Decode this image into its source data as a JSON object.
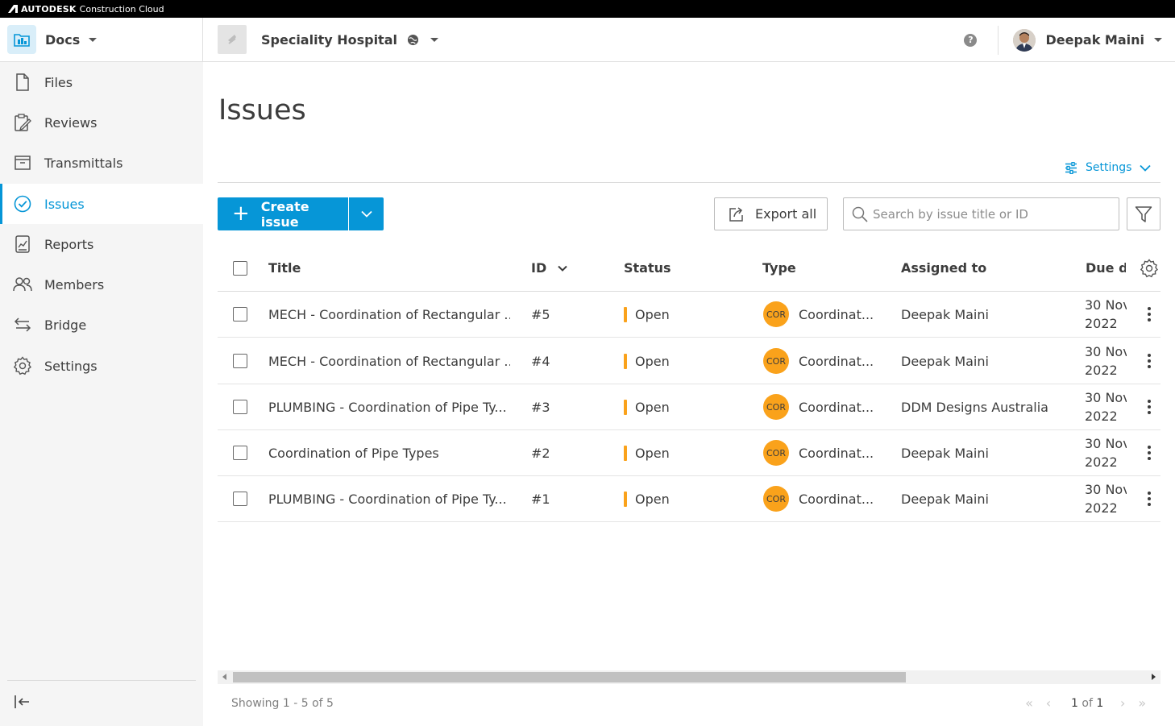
{
  "brand": {
    "name_bold": "AUTODESK",
    "name_rest": "Construction Cloud"
  },
  "header": {
    "module": "Docs",
    "project": "Speciality Hospital",
    "help_glyph": "?",
    "user": "Deepak Maini"
  },
  "sidebar": {
    "items": [
      {
        "label": "Files",
        "icon": "file-icon"
      },
      {
        "label": "Reviews",
        "icon": "review-clipboard-icon"
      },
      {
        "label": "Transmittals",
        "icon": "transmittal-tray-icon"
      },
      {
        "label": "Issues",
        "icon": "check-circle-icon",
        "active": true
      },
      {
        "label": "Reports",
        "icon": "report-icon"
      },
      {
        "label": "Members",
        "icon": "members-icon"
      },
      {
        "label": "Bridge",
        "icon": "bridge-arrows-icon"
      },
      {
        "label": "Settings",
        "icon": "gear-icon"
      }
    ]
  },
  "page": {
    "title": "Issues",
    "settings_label": "Settings"
  },
  "toolbar": {
    "create_label": "Create issue",
    "create_glyph": "+",
    "export_label": "Export all",
    "search_placeholder": "Search by issue title or ID"
  },
  "table": {
    "headers": {
      "title": "Title",
      "id": "ID",
      "status": "Status",
      "type": "Type",
      "assigned": "Assigned to",
      "due": "Due da"
    },
    "rows": [
      {
        "title": "MECH - Coordination of Rectangular ...",
        "id": "#5",
        "status": "Open",
        "type_badge": "COR",
        "type": "Coordinat...",
        "assigned": "Deepak Maini",
        "due_line1": "30 Nov",
        "due_line2": "2022"
      },
      {
        "title": "MECH - Coordination of Rectangular ...",
        "id": "#4",
        "status": "Open",
        "type_badge": "COR",
        "type": "Coordinat...",
        "assigned": "Deepak Maini",
        "due_line1": "30 Nov",
        "due_line2": "2022"
      },
      {
        "title": "PLUMBING - Coordination of Pipe Ty...",
        "id": "#3",
        "status": "Open",
        "type_badge": "COR",
        "type": "Coordinat...",
        "assigned": "DDM Designs Australia",
        "due_line1": "30 Nov",
        "due_line2": "2022"
      },
      {
        "title": "Coordination of Pipe Types",
        "id": "#2",
        "status": "Open",
        "type_badge": "COR",
        "type": "Coordinat...",
        "assigned": "Deepak Maini",
        "due_line1": "30 Nov",
        "due_line2": "2022"
      },
      {
        "title": "PLUMBING - Coordination of Pipe Ty...",
        "id": "#1",
        "status": "Open",
        "type_badge": "COR",
        "type": "Coordinat...",
        "assigned": "Deepak Maini",
        "due_line1": "30 Nov",
        "due_line2": "2022"
      }
    ]
  },
  "footer": {
    "showing": "Showing 1 - 5 of 5",
    "page_current": "1",
    "page_of": "of",
    "page_total": "1"
  },
  "colors": {
    "accent": "#0696d7",
    "status_open": "#faa21b",
    "badge_cor": "#faa21b"
  }
}
